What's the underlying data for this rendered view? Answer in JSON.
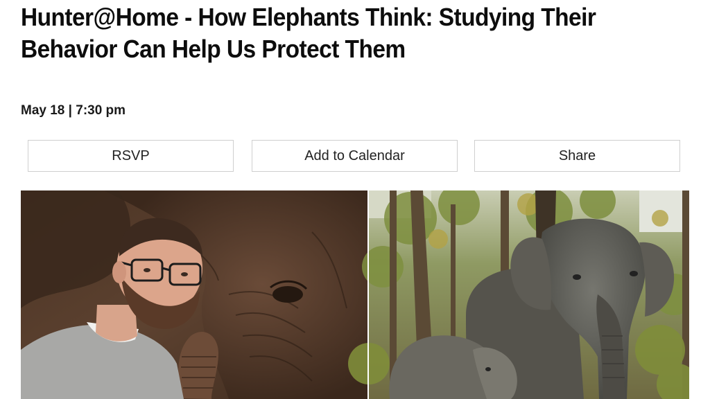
{
  "event": {
    "title": "Hunter@Home - How Elephants Think: Studying Their Behavior Can Help Us Protect Them",
    "date_time": "May 18 | 7:30 pm"
  },
  "actions": {
    "rsvp_label": "RSVP",
    "calendar_label": "Add to Calendar",
    "share_label": "Share"
  },
  "hero": {
    "left_photo": "man-with-elephant-photo",
    "right_photo": "elephants-in-forest-photo"
  },
  "colors": {
    "text": "#0d0d0d",
    "button_border": "#cfcfcf",
    "left_photo_bg": "#5a3f2c",
    "forest_bg": "#9fa07a"
  }
}
